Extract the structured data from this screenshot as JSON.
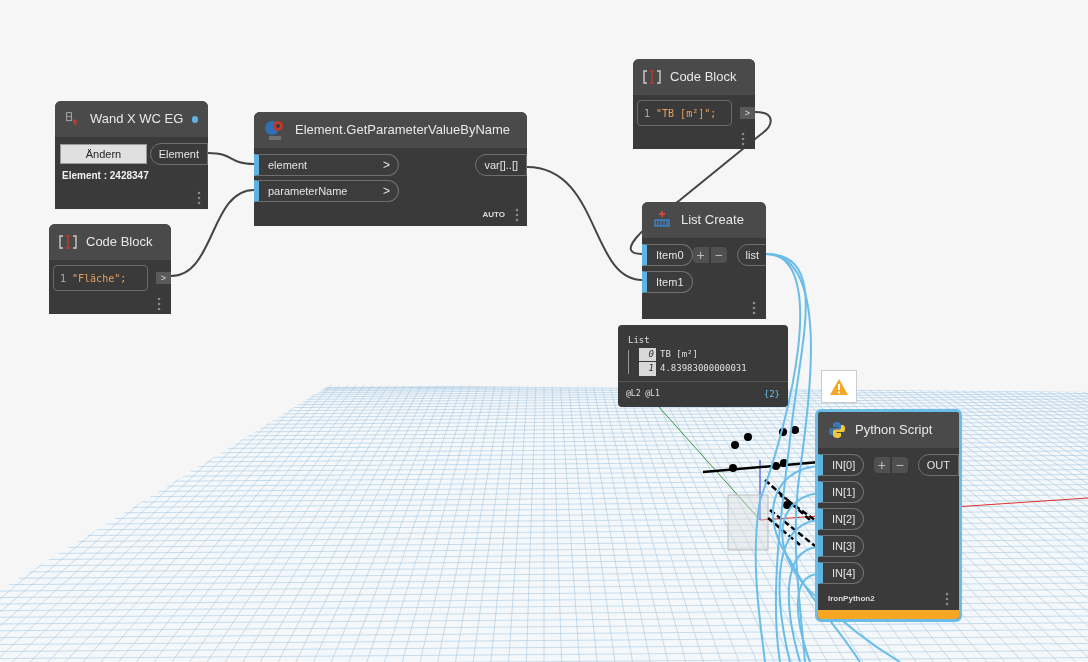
{
  "nodes": [
    {
      "kind": "select",
      "title": "Wand X WC EG",
      "button": "Ändern",
      "outputs": [
        "Element"
      ],
      "info": "Element : 2428347"
    },
    {
      "kind": "code",
      "title": "Code Block",
      "line_number": "1",
      "code": "\"Fläche\";",
      "output": ">"
    },
    {
      "kind": "function",
      "title": "Element.GetParameterValueByName",
      "inputs": [
        {
          "label": "element",
          "arrow": ">"
        },
        {
          "label": "parameterName",
          "arrow": ">"
        }
      ],
      "outputs": [
        "var[]..[]"
      ],
      "lacing": "AUTO"
    },
    {
      "kind": "code",
      "title": "Code Block",
      "line_number": "1",
      "code": "\"TB [m²]\";",
      "output": ">"
    },
    {
      "kind": "list",
      "title": "List Create",
      "inputs": [
        {
          "label": "Item0"
        },
        {
          "label": "Item1"
        }
      ],
      "add": "+",
      "remove": "−",
      "outputs": [
        "list"
      ]
    },
    {
      "kind": "python",
      "title": "Python Script",
      "selected": true,
      "warning": true,
      "inputs": [
        {
          "label": "IN[0]"
        },
        {
          "label": "IN[1]"
        },
        {
          "label": "IN[2]"
        },
        {
          "label": "IN[3]"
        },
        {
          "label": "IN[4]"
        }
      ],
      "add": "+",
      "remove": "−",
      "outputs": [
        "OUT"
      ],
      "engine": "IronPython2"
    }
  ],
  "preview": {
    "title": "List",
    "items": [
      {
        "index": "0",
        "value": "TB [m²]"
      },
      {
        "index": "1",
        "value": "4.83983000000031"
      }
    ],
    "levels": "@L2 @L1",
    "count": "{2}"
  }
}
